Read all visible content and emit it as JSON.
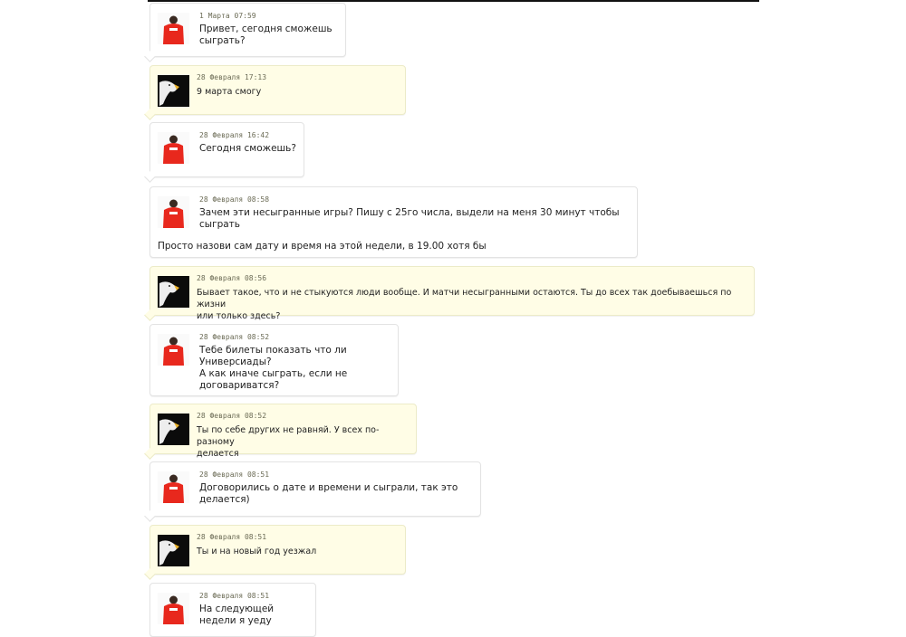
{
  "messages": [
    {
      "who": "red",
      "time": "1 Марта 07:59",
      "text": "Привет, сегодня сможешь\nсыграть?"
    },
    {
      "who": "eagle",
      "time": "28 Февраля 17:13",
      "text": "9 марта смогу"
    },
    {
      "who": "red",
      "time": "28 Февраля 16:42",
      "text": "Сегодня сможешь?"
    },
    {
      "who": "red",
      "time": "28 Февраля 08:58",
      "text": "Зачем эти несыгранные игры? Пишу с 25го числа, выдели на меня 30 минут чтобы\nсыграть",
      "extra": "Просто назови сам дату и время на этой недели, в 19.00 хотя бы"
    },
    {
      "who": "eagle",
      "time": "28 Февраля 08:56",
      "text": "Бывает такое, что и не стыкуются люди вообще. И матчи несыгранными остаются. Ты до всех так доебываешься по жизни\nили только здесь?"
    },
    {
      "who": "red",
      "time": "28 Февраля 08:52",
      "text": "Тебе билеты показать что ли\nУниверсиады?\nА как иначе сыграть, если не\nдоговариватся?"
    },
    {
      "who": "eagle",
      "time": "28 Февраля 08:52",
      "text": "Ты по себе других не равняй. У всех по-разному\nделается"
    },
    {
      "who": "red",
      "time": "28 Февраля 08:51",
      "text": "Договорились о дате и времени и сыграли, так это\nделается)"
    },
    {
      "who": "eagle",
      "time": "28 Февраля 08:51",
      "text": "Ты и на новый год уезжал"
    },
    {
      "who": "red",
      "time": "28 Февраля 08:51",
      "text": "На следующей\nнедели я уеду"
    }
  ],
  "colors": {
    "mine_bg": "#fffde6",
    "other_bg": "#ffffff",
    "jacket": "#e8281d"
  }
}
